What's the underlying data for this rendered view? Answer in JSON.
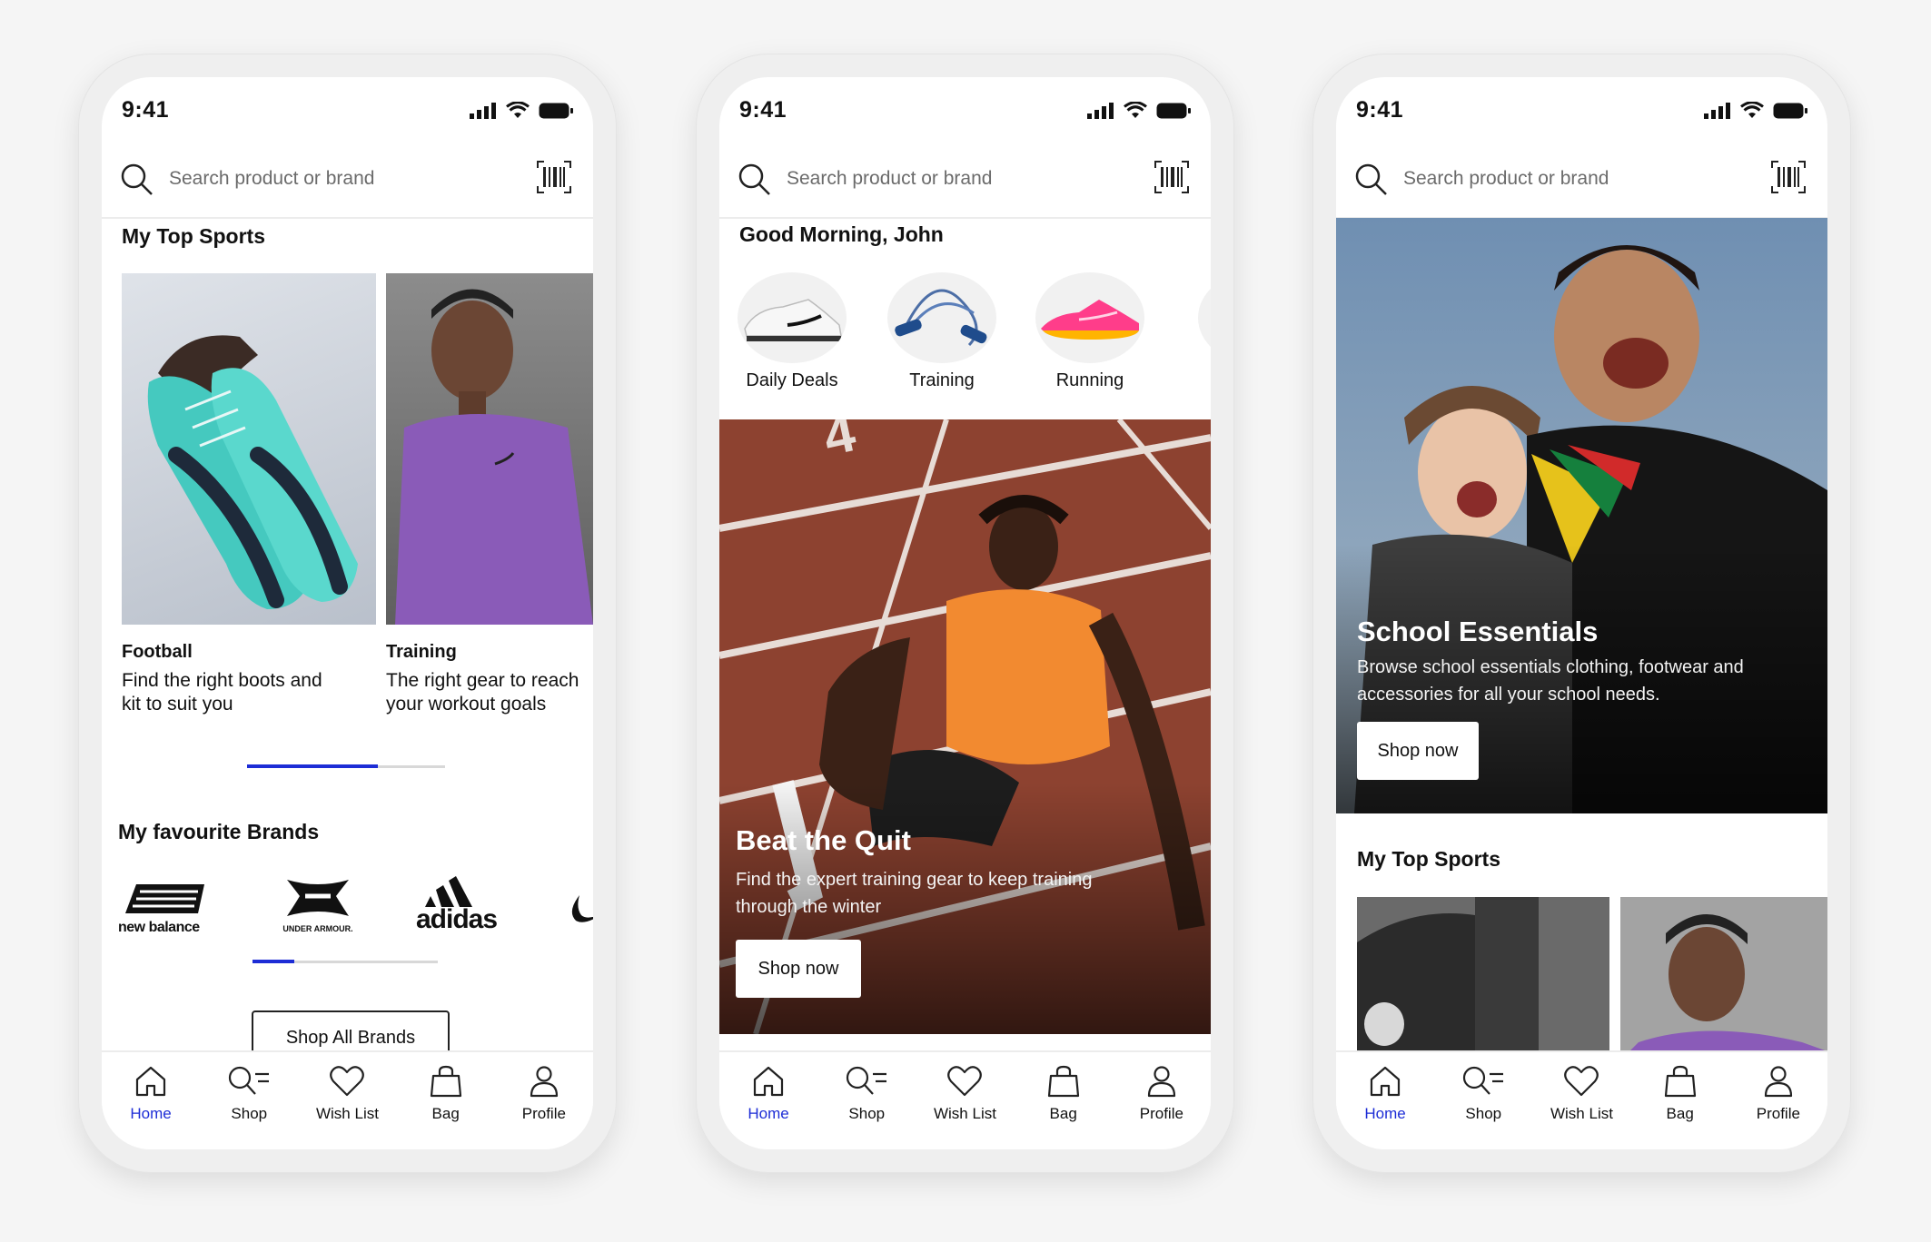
{
  "common": {
    "time": "9:41",
    "search_placeholder": "Search product or brand",
    "tabs": [
      "Home",
      "Shop",
      "Wish List",
      "Bag",
      "Profile"
    ],
    "active_tab": "Home",
    "accent_color": "#1d2dd6"
  },
  "screen1": {
    "section_title": "My Top Sports",
    "sports": [
      {
        "name": "Football",
        "desc_line1": "Find the right boots and",
        "desc_line2": "kit to suit you"
      },
      {
        "name": "Training",
        "desc_line1": "The right gear to reach",
        "desc_line2": "your workout goals"
      }
    ],
    "brands_title": "My favourite Brands",
    "brands": [
      "new balance",
      "UNDER ARMOUR.",
      "adidas"
    ],
    "shop_all_label": "Shop All Brands"
  },
  "screen2": {
    "greeting": "Good Morning, John",
    "categories": [
      "Daily Deals",
      "Training",
      "Running"
    ],
    "hero_title": "Beat the Quit",
    "hero_desc_line1": "Find the expert training gear to keep training",
    "hero_desc_line2": "through the winter",
    "hero_button": "Shop now"
  },
  "screen3": {
    "hero_title": "School Essentials",
    "hero_desc_line1": "Browse school essentials clothing, footwear and",
    "hero_desc_line2": "accessories for all your school needs.",
    "hero_button": "Shop now",
    "section_title": "My Top Sports"
  }
}
